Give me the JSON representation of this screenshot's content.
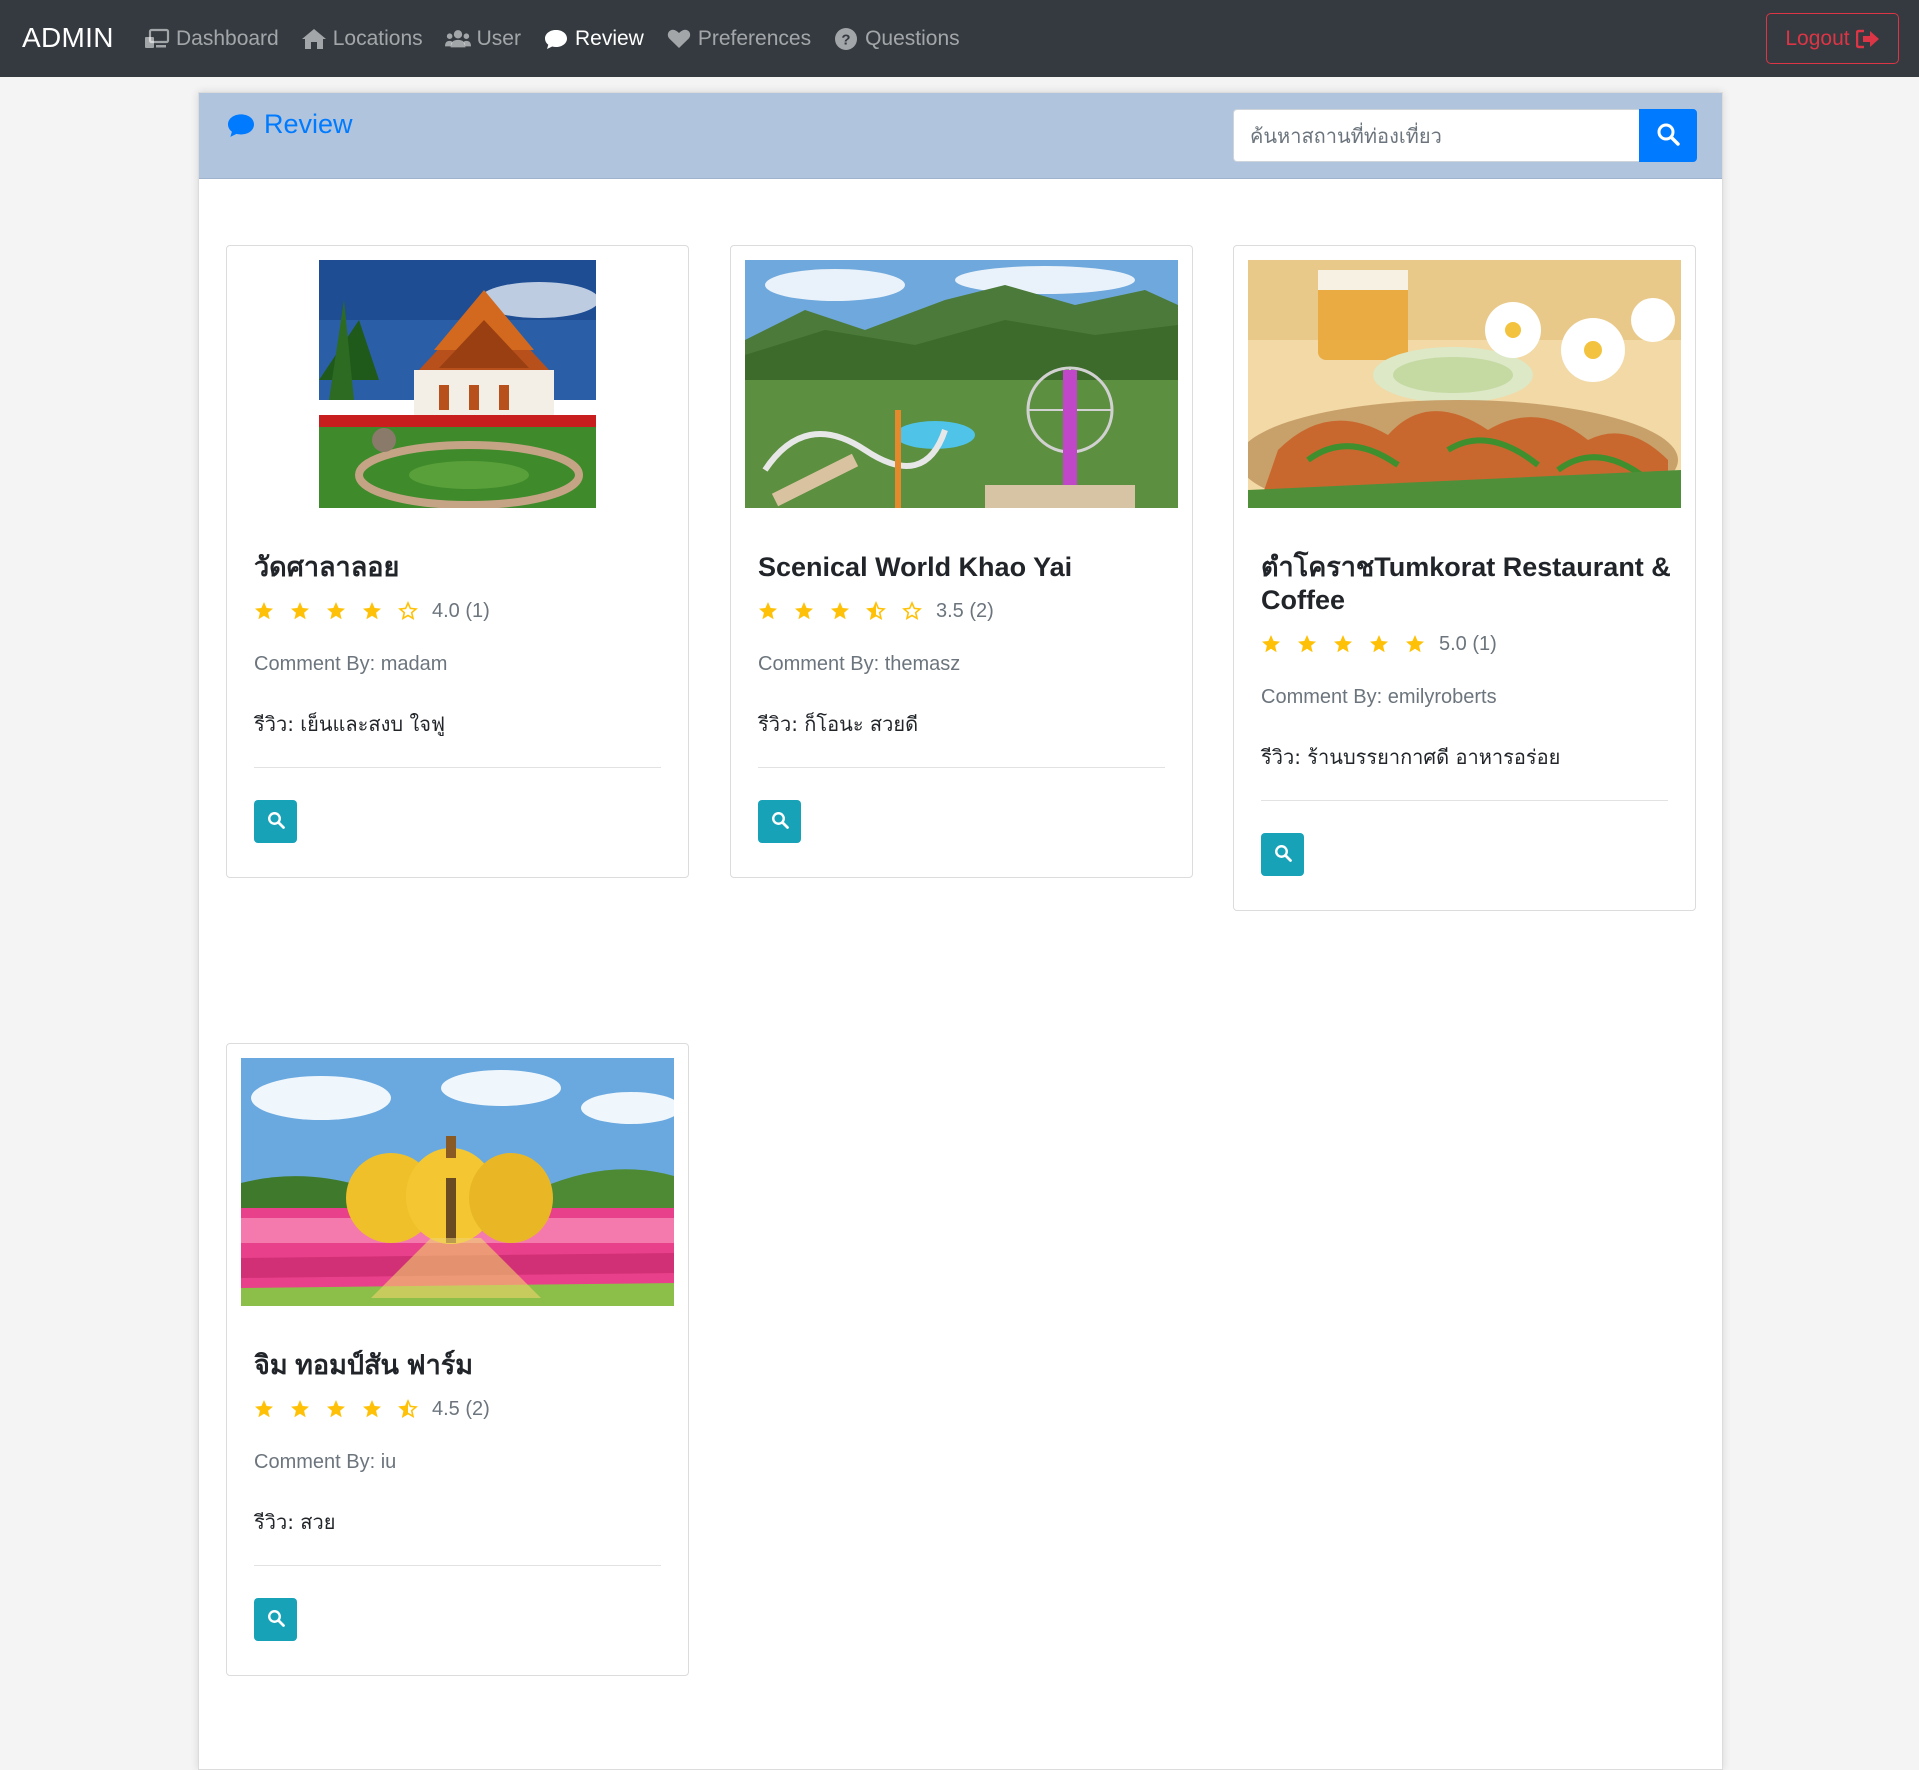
{
  "navbar": {
    "brand": "ADMIN",
    "items": [
      {
        "label": "Dashboard",
        "icon": "dashboard-icon",
        "active": false
      },
      {
        "label": "Locations",
        "icon": "home-icon",
        "active": false
      },
      {
        "label": "User",
        "icon": "users-icon",
        "active": false
      },
      {
        "label": "Review",
        "icon": "comment-icon",
        "active": true
      },
      {
        "label": "Preferences",
        "icon": "heart-icon",
        "active": false
      },
      {
        "label": "Questions",
        "icon": "question-circle-icon",
        "active": false
      }
    ],
    "logout_label": "Logout",
    "logout_icon": "sign-out-icon"
  },
  "header": {
    "title": "Review",
    "title_icon": "comment-icon",
    "search_placeholder": "ค้นหาสถานที่ท่องเที่ยว",
    "search_icon": "search-icon"
  },
  "reviews": [
    {
      "title": "วัดศาลาลอย",
      "rating": 4.0,
      "rating_text": "4.0 (1)",
      "stars": [
        "full",
        "full",
        "full",
        "full",
        "empty"
      ],
      "comment_by": "Comment By: madam",
      "review": "รีวิว: เย็นและสงบ ใจฟู",
      "image": "temple-photo"
    },
    {
      "title": "Scenical World Khao Yai",
      "rating": 3.5,
      "rating_text": "3.5 (2)",
      "stars": [
        "full",
        "full",
        "full",
        "half",
        "empty"
      ],
      "comment_by": "Comment By: themasz",
      "review": "รีวิว: ก็โอนะ สวยดี",
      "image": "theme-park-photo"
    },
    {
      "title": "ตำโคราชTumkorat Restaurant & Coffee",
      "rating": 5.0,
      "rating_text": "5.0 (1)",
      "stars": [
        "full",
        "full",
        "full",
        "full",
        "full"
      ],
      "comment_by": "Comment By: emilyroberts",
      "review": "รีวิว: ร้านบรรยากาศดี อาหารอร่อย",
      "image": "thai-food-photo"
    },
    {
      "title": "จิม ทอมป์สัน ฟาร์ม",
      "rating": 4.5,
      "rating_text": "4.5 (2)",
      "stars": [
        "full",
        "full",
        "full",
        "full",
        "half"
      ],
      "comment_by": "Comment By: iu",
      "review": "รีวิว: สวย",
      "image": "pumpkin-farm-photo"
    }
  ],
  "colors": {
    "navbar_bg": "#343a40",
    "header_bg": "#b0c4de",
    "primary": "#007bff",
    "info": "#17a2b8",
    "danger": "#dc3545",
    "star": "#ffc107"
  }
}
